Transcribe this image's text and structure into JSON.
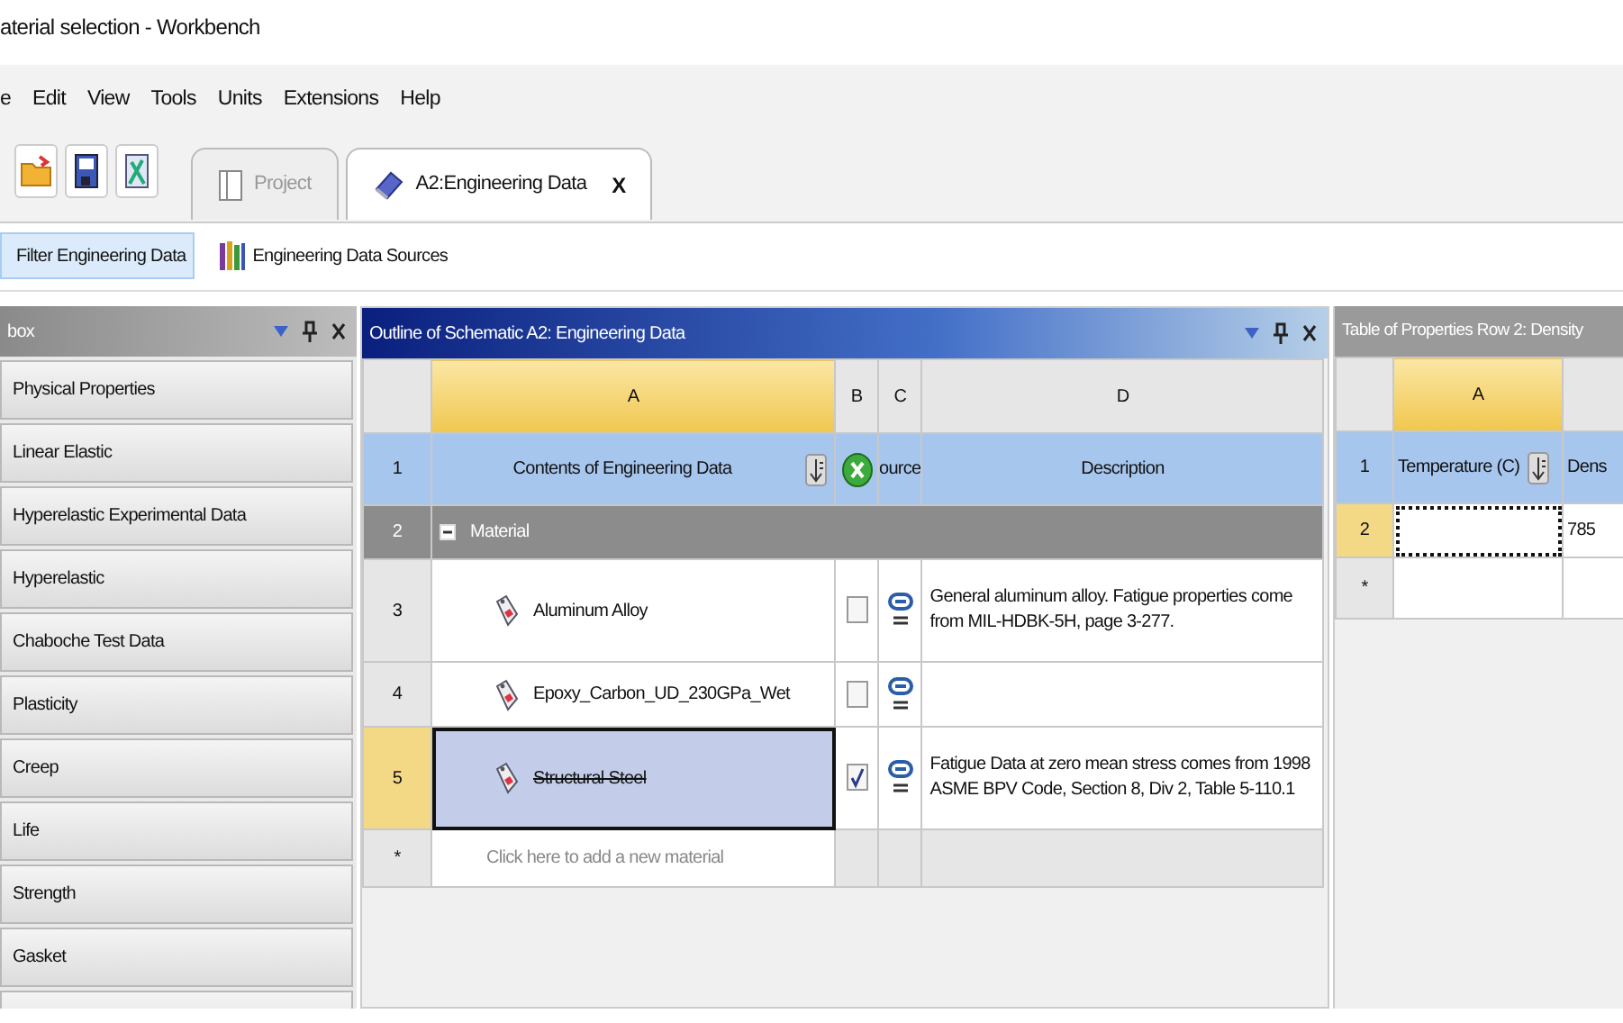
{
  "window": {
    "title": "aterial selection - Workbench"
  },
  "menu": [
    "e",
    "Edit",
    "View",
    "Tools",
    "Units",
    "Extensions",
    "Help"
  ],
  "tabs": [
    {
      "label": "Project",
      "selected": false
    },
    {
      "label": "A2:Engineering Data",
      "selected": true,
      "close": "X"
    }
  ],
  "sub_toolbar": [
    {
      "label": "Filter Engineering Data",
      "selected": true
    },
    {
      "label": "Engineering Data Sources",
      "selected": false
    }
  ],
  "toolbox": {
    "title": "box",
    "items": [
      "Physical Properties",
      "Linear Elastic",
      "Hyperelastic Experimental Data",
      "Hyperelastic",
      "Chaboche Test Data",
      "Plasticity",
      "Creep",
      "Life",
      "Strength",
      "Gasket"
    ]
  },
  "outline": {
    "title": "Outline of Schematic A2: Engineering Data",
    "columns": [
      "A",
      "B",
      "C",
      "D"
    ],
    "header": {
      "row": "1",
      "contents": "Contents of Engineering Data",
      "source": "ource",
      "description": "Description"
    },
    "group": {
      "row": "2",
      "label": "Material",
      "expanded": true
    },
    "rows": [
      {
        "row": "3",
        "name": "Aluminum Alloy",
        "checked": false,
        "suppressed": false,
        "selected": false,
        "description": "General aluminum alloy. Fatigue properties come from MIL-HDBK-5H, page 3-277."
      },
      {
        "row": "4",
        "name": "Epoxy_Carbon_UD_230GPa_Wet",
        "checked": false,
        "suppressed": false,
        "selected": false
      },
      {
        "row": "5",
        "name": "Structural Steel",
        "checked": true,
        "suppressed": true,
        "selected": true,
        "description": "Fatigue Data at zero mean stress comes from 1998 ASME BPV Code, Section 8, Div 2, Table 5-110.1"
      }
    ],
    "new_row": {
      "marker": "*",
      "placeholder": "Click here to add a new material"
    }
  },
  "properties": {
    "title": "Table of Properties Row 2: Density",
    "columns": [
      "A"
    ],
    "header": {
      "row": "1",
      "temperature": "Temperature (C)",
      "density": "Dens"
    },
    "rows": [
      {
        "row": "2",
        "density": "785",
        "selected": true
      }
    ],
    "new_row": {
      "marker": "*"
    }
  }
}
